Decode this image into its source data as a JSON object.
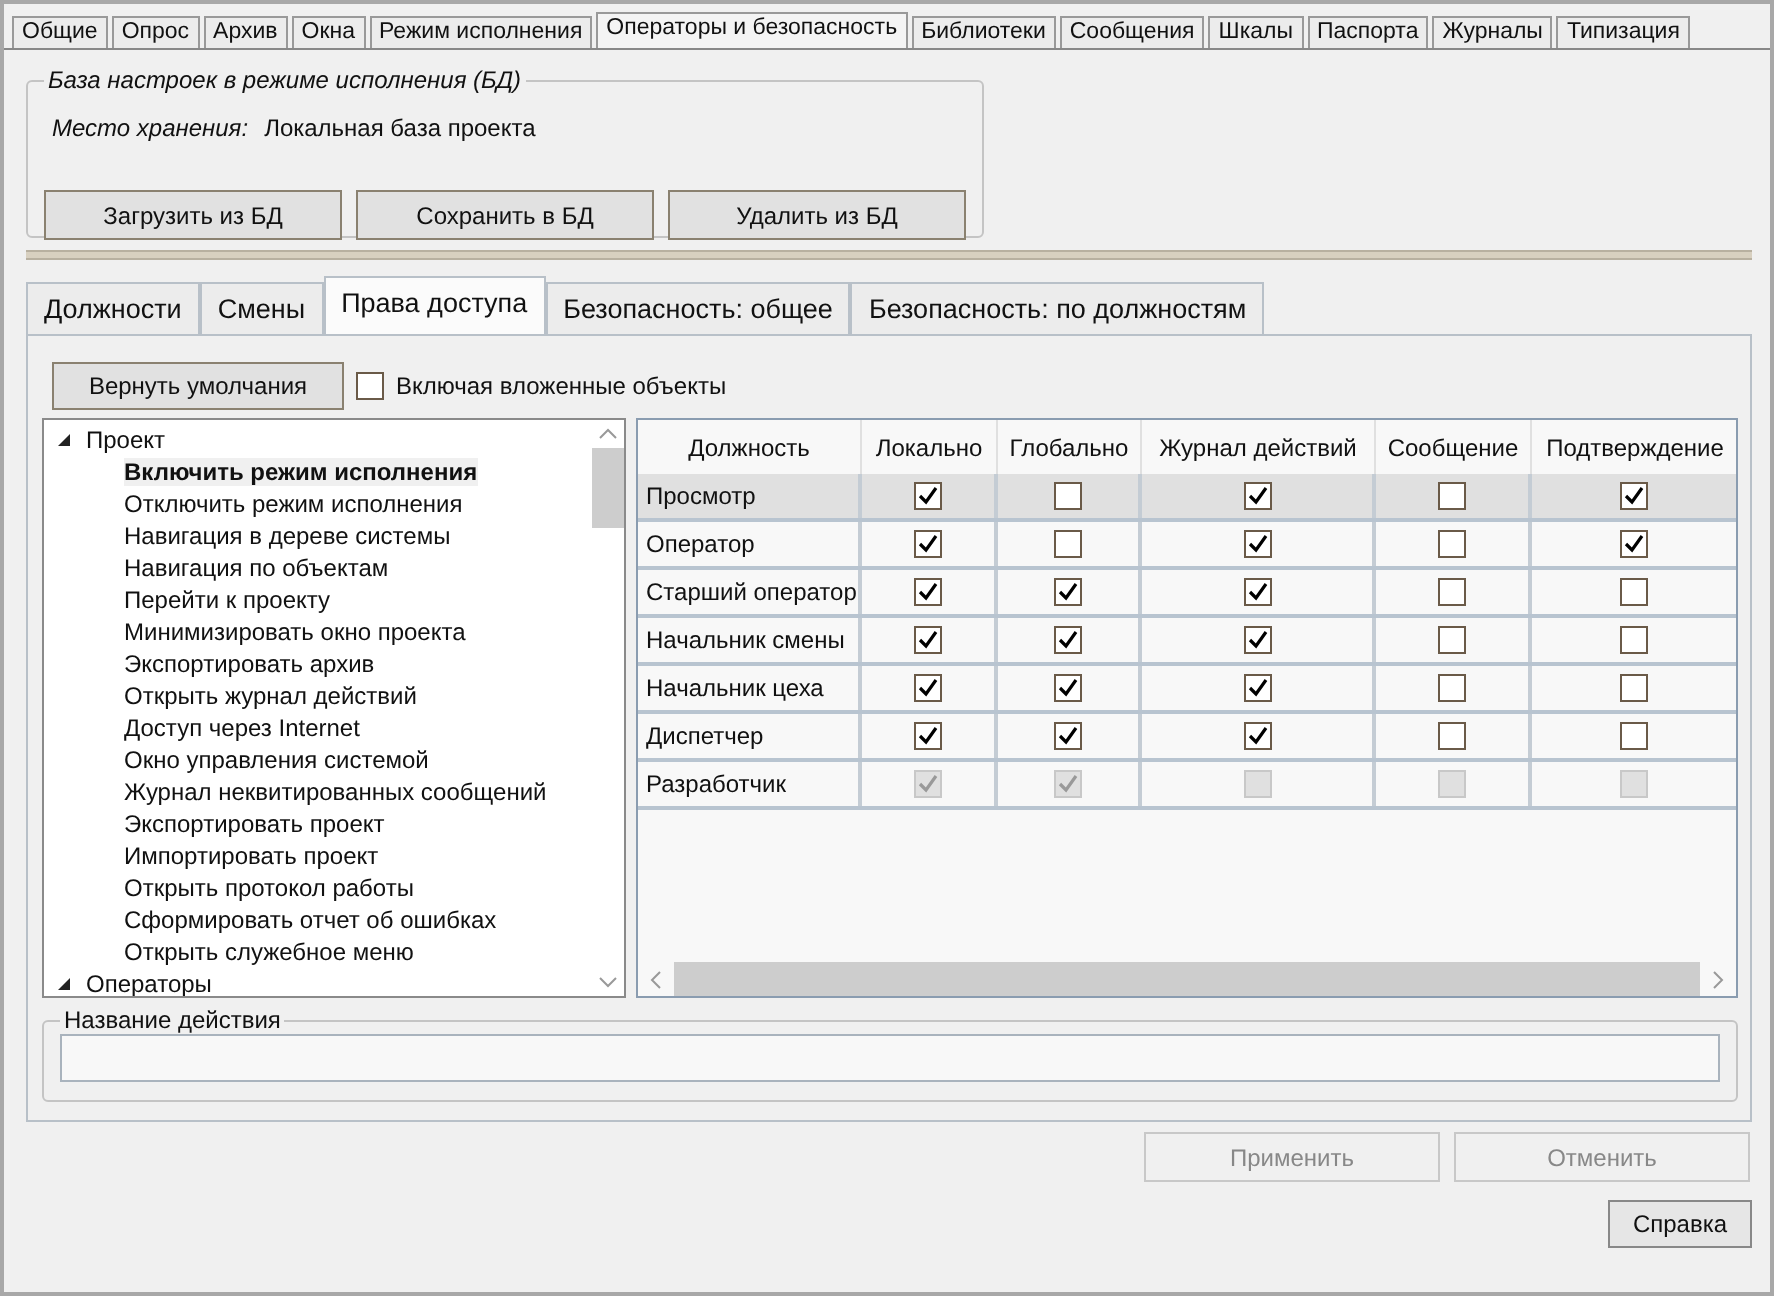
{
  "tabs": [
    {
      "label": "Общие",
      "selected": false
    },
    {
      "label": "Опрос",
      "selected": false
    },
    {
      "label": "Архив",
      "selected": false
    },
    {
      "label": "Окна",
      "selected": false
    },
    {
      "label": "Режим исполнения",
      "selected": false
    },
    {
      "label": "Операторы и безопасность",
      "selected": true
    },
    {
      "label": "Библиотеки",
      "selected": false
    },
    {
      "label": "Сообщения",
      "selected": false
    },
    {
      "label": "Шкалы",
      "selected": false
    },
    {
      "label": "Паспорта",
      "selected": false
    },
    {
      "label": "Журналы",
      "selected": false
    },
    {
      "label": "Типизация",
      "selected": false
    }
  ],
  "db_group": {
    "title": "База настроек в режиме исполнения (БД)",
    "storage_label": "Место хранения:",
    "storage_value": "Локальная база проекта",
    "buttons": [
      "Загрузить из БД",
      "Сохранить в БД",
      "Удалить из БД"
    ]
  },
  "subtabs": [
    {
      "label": "Должности",
      "selected": false
    },
    {
      "label": "Смены",
      "selected": false
    },
    {
      "label": "Права доступа",
      "selected": true
    },
    {
      "label": "Безопасность: общее",
      "selected": false
    },
    {
      "label": "Безопасность: по должностям",
      "selected": false
    }
  ],
  "reset_button": "Вернуть умолчания",
  "include_nested": {
    "label": "Включая вложенные объекты",
    "checked": false
  },
  "tree": [
    {
      "label": "Проект",
      "expanded": true,
      "children": [
        {
          "label": "Включить режим исполнения",
          "selected": true
        },
        {
          "label": "Отключить режим исполнения",
          "selected": false
        },
        {
          "label": "Навигация в дереве системы",
          "selected": false
        },
        {
          "label": "Навигация по объектам",
          "selected": false
        },
        {
          "label": "Перейти к проекту",
          "selected": false
        },
        {
          "label": "Минимизировать окно проекта",
          "selected": false
        },
        {
          "label": "Экспортировать архив",
          "selected": false
        },
        {
          "label": "Открыть журнал действий",
          "selected": false
        },
        {
          "label": "Доступ через Internet",
          "selected": false
        },
        {
          "label": "Окно управления системой",
          "selected": false
        },
        {
          "label": "Журнал неквитированных сообщений",
          "selected": false
        },
        {
          "label": "Экспортировать проект",
          "selected": false
        },
        {
          "label": "Импортировать проект",
          "selected": false
        },
        {
          "label": "Открыть протокол работы",
          "selected": false
        },
        {
          "label": "Сформировать отчет об ошибках",
          "selected": false
        },
        {
          "label": "Открыть служебное меню",
          "selected": false
        }
      ]
    },
    {
      "label": "Операторы",
      "expanded": true
    }
  ],
  "table": {
    "columns": [
      "Должность",
      "Локально",
      "Глобально",
      "Журнал действий",
      "Сообщение",
      "Подтверждение"
    ],
    "rows": [
      {
        "role": "Просмотр",
        "selected": true,
        "disabled": false,
        "cells": [
          true,
          false,
          true,
          false,
          true
        ]
      },
      {
        "role": "Оператор",
        "selected": false,
        "disabled": false,
        "cells": [
          true,
          false,
          true,
          false,
          true
        ]
      },
      {
        "role": "Старший оператор",
        "selected": false,
        "disabled": false,
        "cells": [
          true,
          true,
          true,
          false,
          false
        ]
      },
      {
        "role": "Начальник смены",
        "selected": false,
        "disabled": false,
        "cells": [
          true,
          true,
          true,
          false,
          false
        ]
      },
      {
        "role": "Начальник цеха",
        "selected": false,
        "disabled": false,
        "cells": [
          true,
          true,
          true,
          false,
          false
        ]
      },
      {
        "role": "Диспетчер",
        "selected": false,
        "disabled": false,
        "cells": [
          true,
          true,
          true,
          false,
          false
        ]
      },
      {
        "role": "Разработчик",
        "selected": false,
        "disabled": true,
        "cells": [
          true,
          true,
          false,
          false,
          false
        ]
      }
    ]
  },
  "action_name": {
    "label": "Название действия"
  },
  "footer_buttons": [
    {
      "label": "Применить",
      "disabled": true
    },
    {
      "label": "Отменить",
      "disabled": true
    }
  ],
  "help_button": "Справка"
}
